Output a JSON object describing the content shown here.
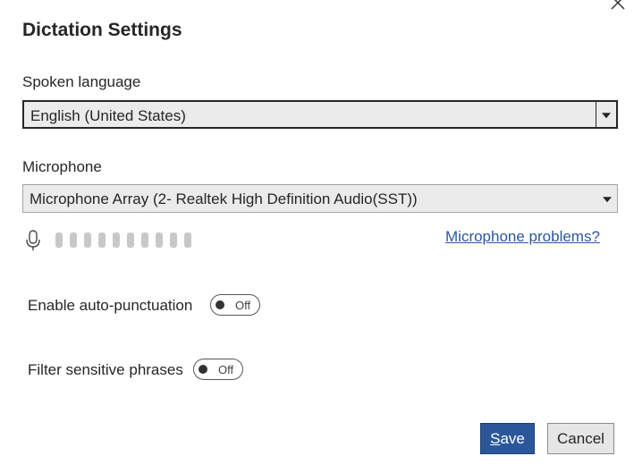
{
  "dialog": {
    "title": "Dictation Settings"
  },
  "spoken_language": {
    "label": "Spoken language",
    "selected": "English (United States)"
  },
  "microphone": {
    "label": "Microphone",
    "selected": "Microphone Array (2- Realtek High Definition Audio(SST))",
    "level_segments_total": 10,
    "level_segments_active": 0,
    "problems_link": "Microphone problems?"
  },
  "auto_punctuation": {
    "label": "Enable auto-punctuation",
    "state": "Off"
  },
  "filter_phrases": {
    "label": "Filter sensitive phrases",
    "state": "Off"
  },
  "buttons": {
    "save_first": "S",
    "save_rest": "ave",
    "cancel": "Cancel"
  },
  "colors": {
    "accent": "#2b579a",
    "select_bg": "#ebebeb",
    "level_inactive": "#c8c8c8"
  },
  "icons": {
    "close": "close-icon",
    "microphone": "microphone-icon",
    "dropdown": "chevron-down-icon"
  }
}
